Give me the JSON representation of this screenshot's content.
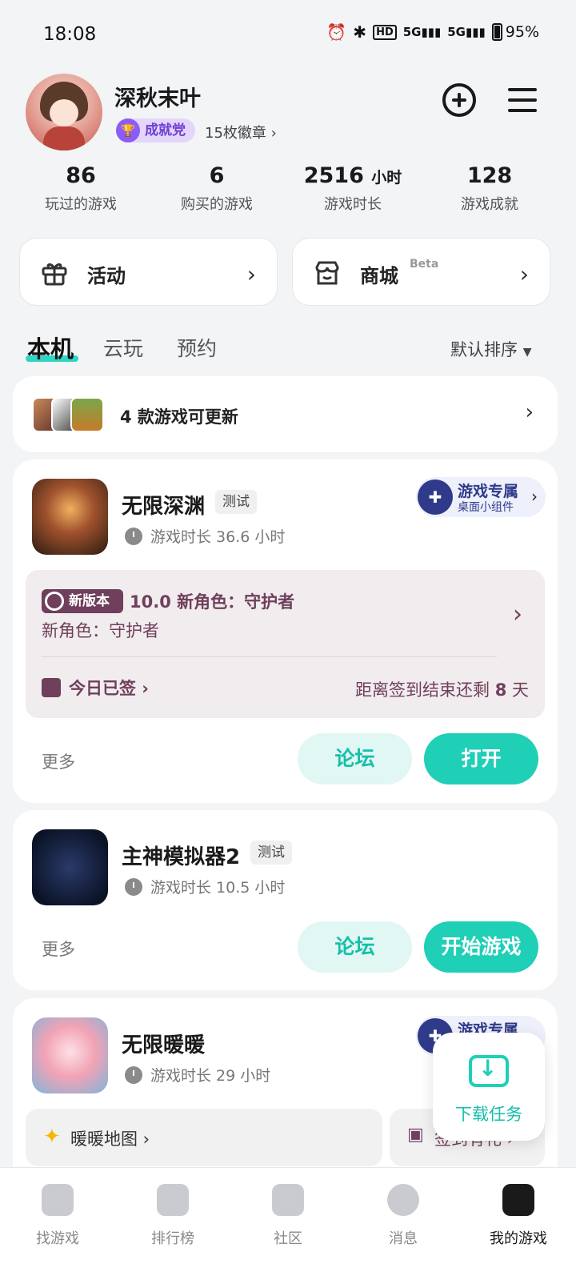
{
  "status_bar": {
    "time": "18:08",
    "battery": "95%",
    "icons": [
      "alarm-icon",
      "bluetooth-icon",
      "hd-icon",
      "signal-5g-icon",
      "signal-5g-icon"
    ]
  },
  "profile": {
    "username": "深秋末叶",
    "badge_label": "成就党",
    "badge_count": "15枚徽章 ›"
  },
  "stats": [
    {
      "value": "86",
      "unit": "",
      "label": "玩过的游戏"
    },
    {
      "value": "6",
      "unit": "",
      "label": "购买的游戏"
    },
    {
      "value": "2516",
      "unit": "小时",
      "label": "游戏时长"
    },
    {
      "value": "128",
      "unit": "",
      "label": "游戏成就"
    }
  ],
  "quick_cards": {
    "activity": "活动",
    "shop": "商城",
    "shop_tag": "Beta"
  },
  "tabs": [
    "本机",
    "云玩",
    "预约"
  ],
  "sort_label": "默认排序",
  "update_notice": "4 款游戏可更新",
  "games": [
    {
      "title": "无限深渊",
      "tag": "测试",
      "playtime": "游戏时长 36.6 小时",
      "widget_title": "游戏专属",
      "widget_sub": "桌面小组件",
      "event": {
        "badge": "新版本",
        "title": "10.0 新角色：守护者",
        "desc": "新角色：守护者",
        "signed": "今日已签 ›",
        "remain_prefix": "距离签到结束还剩 ",
        "remain_days": "8",
        "remain_suffix": " 天"
      },
      "more": "更多",
      "forum": "论坛",
      "action": "打开"
    },
    {
      "title": "主神模拟器2",
      "tag": "测试",
      "playtime": "游戏时长 10.5 小时",
      "more": "更多",
      "forum": "论坛",
      "action": "开始游戏"
    },
    {
      "title": "无限暖暖",
      "playtime": "游戏时长 29 小时",
      "widget_title": "游戏专属",
      "sub_left": "暖暖地图 ›",
      "sub_right": "签到有礼 ›"
    }
  ],
  "download_float": "下载任务",
  "bottom_nav": [
    "找游戏",
    "排行榜",
    "社区",
    "消息",
    "我的游戏"
  ],
  "colors": {
    "accent": "#1fcfb6",
    "accent_light": "#e0f7f4",
    "event_text": "#6f3f5c",
    "badge_purple": "#8b5cf6"
  }
}
